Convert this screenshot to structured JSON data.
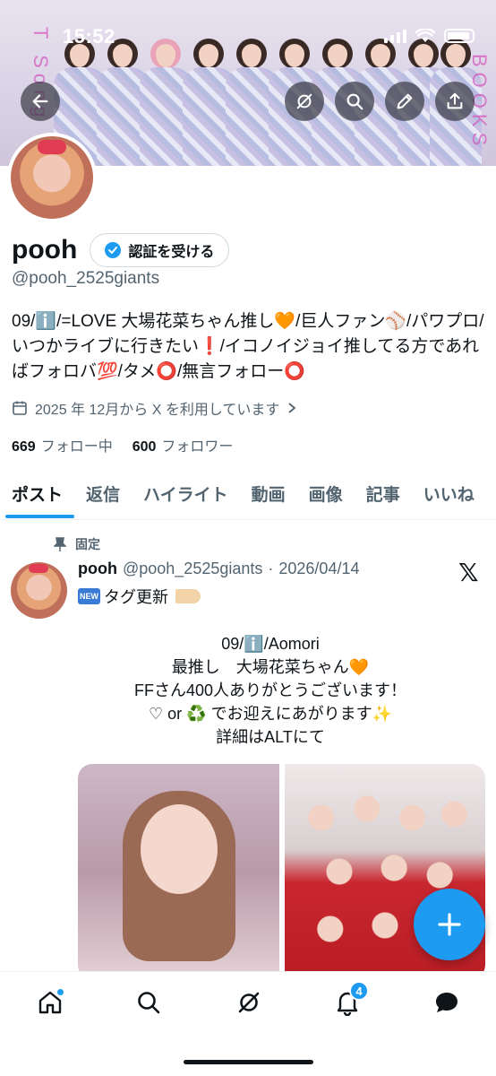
{
  "status": {
    "time": "15:52"
  },
  "banner": {
    "left_text": "T Song",
    "right_text": "BOOKS"
  },
  "header_buttons": [
    "back-icon",
    "grok-icon",
    "search-icon",
    "edit-icon",
    "share-icon"
  ],
  "profile": {
    "name": "pooh",
    "verify_label": "認証を受ける",
    "handle": "@pooh_2525giants",
    "bio": "09/ℹ️/=LOVE 大場花菜ちゃん推し🧡/巨人ファン⚾/パワプロ/いつかライブに行きたい❗/イコノイジョイ推してる方であればフォロバ💯/タメ⭕/無言フォロー⭕",
    "joined": "2025 年 12月から X を利用しています",
    "following_count": "669",
    "following_label": "フォロー中",
    "followers_count": "600",
    "followers_label": "フォロワー"
  },
  "tabs": [
    "ポスト",
    "返信",
    "ハイライト",
    "動画",
    "画像",
    "記事",
    "いいね"
  ],
  "post": {
    "pinned_label": "固定",
    "name": "pooh",
    "handle": "@pooh_2525giants",
    "separator": "·",
    "date": "2026/04/14",
    "new_badge": "NEW",
    "tag_text": "タグ更新",
    "body_lines": [
      "09/ℹ️/Aomori",
      "最推し　大場花菜ちゃん🧡",
      "FFさん400人ありがとうございます！",
      "♡ or ♻️ でお迎えにあがります✨",
      "詳細はALTにて"
    ]
  },
  "bottom_nav": {
    "notification_count": "4"
  },
  "colors": {
    "accent": "#1d9bf0",
    "text": "#0f1419",
    "muted": "#536471"
  }
}
